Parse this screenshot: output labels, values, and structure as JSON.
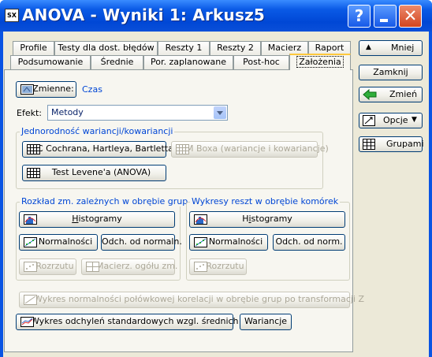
{
  "window": {
    "title": "ANOVA - Wyniki 1: Arkusz5",
    "app_icon": "SX"
  },
  "title_buttons": {
    "help": "?",
    "close": "✕"
  },
  "tabs": {
    "row1": [
      "Profile",
      "Testy dla dost. błędów",
      "Reszty 1",
      "Reszty 2",
      "Macierz",
      "Raport"
    ],
    "row2": [
      "Podsumowanie",
      "Średnie",
      "Por. zaplanowane",
      "Post-hoc",
      "Założenia"
    ],
    "active": "Założenia"
  },
  "vars": {
    "button_label": "Zmienne:",
    "value": "Czas"
  },
  "effect": {
    "label": "Efekt:",
    "value": "Metody"
  },
  "group_homog": {
    "title": "Jednorodność wariancji/kowariancji",
    "cochran": "C Cochrana, Hartleya, Bartletta",
    "boxm": "M Boxa (wariancje i kowariancje)",
    "levene": "Test Levene'a (ANOVA)"
  },
  "group_dist": {
    "title": "Rozkład zm. zależnych w obrębie grup",
    "histogram": "Histogramy",
    "normal": "Normalności",
    "odch": "Odch. od normaln.",
    "rozrzut": "Rozrzutu",
    "macierz": "Macierz. ogółu zm."
  },
  "group_resid": {
    "title": "Wykresy reszt w obrębie komórek",
    "histogram": "Histogramy",
    "normal": "Normalności",
    "odch": "Odch. od norm.",
    "rozrzut": "Rozrzutu"
  },
  "bottom": {
    "halfnormal": "Wykres normalności połówkowej korelacji w obrębie grup po transformacji Z",
    "stddev": "Wykres odchyleń standardowych wzgl. średnich",
    "variances": "Wariancje"
  },
  "side": {
    "less": "Mniej",
    "close": "Zamknij",
    "change": "Zmień",
    "options": "Opcje",
    "groups": "Grupami"
  },
  "colors": {
    "title_bar": "#0a5ae6",
    "link": "#0046d5",
    "tab_active_accent": "#ffc83c"
  }
}
